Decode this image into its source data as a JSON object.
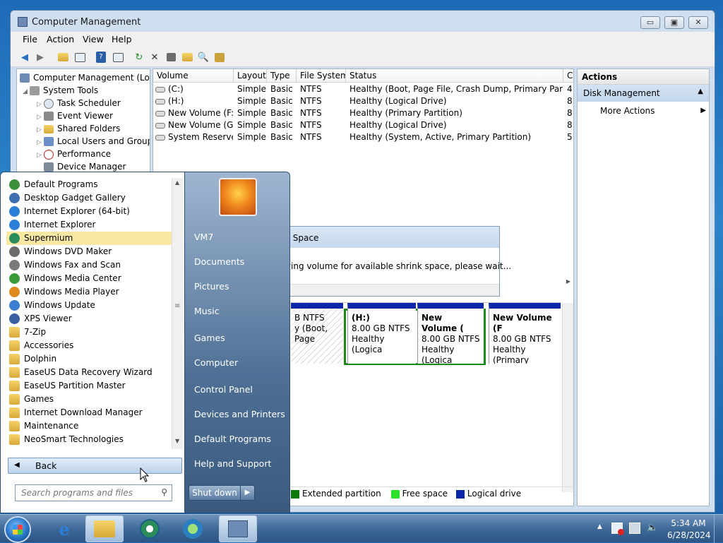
{
  "window": {
    "title": "Computer Management",
    "controls": {
      "minimize": "▭",
      "maximize": "▣",
      "close": "✕"
    }
  },
  "menubar": [
    "File",
    "Action",
    "View",
    "Help"
  ],
  "tree": {
    "root": "Computer Management (Local",
    "items": [
      {
        "label": "System Tools",
        "indent": 1,
        "icon": "tools-icon"
      },
      {
        "label": "Task Scheduler",
        "indent": 2,
        "icon": "clock-icon"
      },
      {
        "label": "Event Viewer",
        "indent": 2,
        "icon": "event-icon"
      },
      {
        "label": "Shared Folders",
        "indent": 2,
        "icon": "folder-icon"
      },
      {
        "label": "Local Users and Groups",
        "indent": 2,
        "icon": "users-icon"
      },
      {
        "label": "Performance",
        "indent": 2,
        "icon": "performance-icon"
      },
      {
        "label": "Device Manager",
        "indent": 2,
        "icon": "device-icon"
      }
    ]
  },
  "volumes": {
    "headers": [
      "Volume",
      "Layout",
      "Type",
      "File System",
      "Status",
      "C"
    ],
    "rows": [
      [
        "(C:)",
        "Simple",
        "Basic",
        "NTFS",
        "Healthy (Boot, Page File, Crash Dump, Primary Partition)",
        "4"
      ],
      [
        "(H:)",
        "Simple",
        "Basic",
        "NTFS",
        "Healthy (Logical Drive)",
        "8"
      ],
      [
        "New Volume (F:)",
        "Simple",
        "Basic",
        "NTFS",
        "Healthy (Primary Partition)",
        "8"
      ],
      [
        "New Volume (G:)",
        "Simple",
        "Basic",
        "NTFS",
        "Healthy (Logical Drive)",
        "8"
      ],
      [
        "System Reserved",
        "Simple",
        "Basic",
        "NTFS",
        "Healthy (System, Active, Primary Partition)",
        "5"
      ]
    ]
  },
  "disk_map": {
    "partitions": [
      {
        "name": "",
        "size": "B NTFS",
        "status": "y (Boot, Page"
      },
      {
        "name": "(H:)",
        "size": "8.00 GB NTFS",
        "status": "Healthy (Logica"
      },
      {
        "name": "New Volume  (",
        "size": "8.00 GB NTFS",
        "status": "Healthy (Logica"
      },
      {
        "name": "New Volume  (F",
        "size": "8.00 GB NTFS",
        "status": "Healthy (Primary"
      }
    ],
    "legend": [
      {
        "label": "Extended partition",
        "color": "#0b7a0b"
      },
      {
        "label": "Free space",
        "color": "#2ee02e"
      },
      {
        "label": "Logical drive",
        "color": "#0b26a8"
      }
    ]
  },
  "actions": {
    "title": "Actions",
    "section": "Disk Management",
    "more": "More Actions"
  },
  "dialog": {
    "title": "k Space",
    "message": "rying volume for available shrink space, please wait..."
  },
  "start_menu": {
    "programs": [
      {
        "label": "Default Programs",
        "icon": "default-programs-icon",
        "color": "#3a8f3a"
      },
      {
        "label": "Desktop Gadget Gallery",
        "icon": "gadget-icon",
        "color": "#3d6fb0"
      },
      {
        "label": "Internet Explorer (64-bit)",
        "icon": "ie-icon",
        "color": "#2c7fd8"
      },
      {
        "label": "Internet Explorer",
        "icon": "ie-icon",
        "color": "#2c7fd8"
      },
      {
        "label": "Supermium",
        "icon": "supermium-icon",
        "color": "#2a8c5a"
      },
      {
        "label": "Windows DVD Maker",
        "icon": "dvd-icon",
        "color": "#6b6b6b"
      },
      {
        "label": "Windows Fax and Scan",
        "icon": "fax-icon",
        "color": "#7a7a7a"
      },
      {
        "label": "Windows Media Center",
        "icon": "media-center-icon",
        "color": "#3a9a3a"
      },
      {
        "label": "Windows Media Player",
        "icon": "media-player-icon",
        "color": "#e08a1e"
      },
      {
        "label": "Windows Update",
        "icon": "update-icon",
        "color": "#3a7fd0"
      },
      {
        "label": "XPS Viewer",
        "icon": "xps-icon",
        "color": "#3a5fa0"
      },
      {
        "label": "7-Zip",
        "icon": "folder-icon",
        "color": "folder"
      },
      {
        "label": "Accessories",
        "icon": "folder-icon",
        "color": "folder"
      },
      {
        "label": "Dolphin",
        "icon": "folder-icon",
        "color": "folder"
      },
      {
        "label": "EaseUS Data Recovery Wizard",
        "icon": "folder-icon",
        "color": "folder"
      },
      {
        "label": "EaseUS Partition Master",
        "icon": "folder-icon",
        "color": "folder"
      },
      {
        "label": "Games",
        "icon": "folder-icon",
        "color": "folder"
      },
      {
        "label": "Internet Download Manager",
        "icon": "folder-icon",
        "color": "folder"
      },
      {
        "label": "Maintenance",
        "icon": "folder-icon",
        "color": "folder"
      },
      {
        "label": "NeoSmart Technologies",
        "icon": "folder-icon",
        "color": "folder"
      }
    ],
    "selected_index": 4,
    "back": "Back",
    "search_placeholder": "Search programs and files",
    "right_links": [
      {
        "label": "VM7",
        "name": "sm-link-user"
      },
      {
        "label": "Documents",
        "name": "sm-link-documents"
      },
      {
        "label": "Pictures",
        "name": "sm-link-pictures"
      },
      {
        "label": "Music",
        "name": "sm-link-music"
      },
      {
        "label": "Games",
        "name": "sm-link-games"
      },
      {
        "label": "Computer",
        "name": "sm-link-computer"
      },
      {
        "label": "Control Panel",
        "name": "sm-link-control-panel"
      },
      {
        "label": "Devices and Printers",
        "name": "sm-link-devices"
      },
      {
        "label": "Default Programs",
        "name": "sm-link-default-programs"
      },
      {
        "label": "Help and Support",
        "name": "sm-link-help"
      }
    ],
    "shutdown": "Shut down"
  },
  "taskbar": {
    "time": "5:34 AM",
    "date": "6/28/2024"
  }
}
